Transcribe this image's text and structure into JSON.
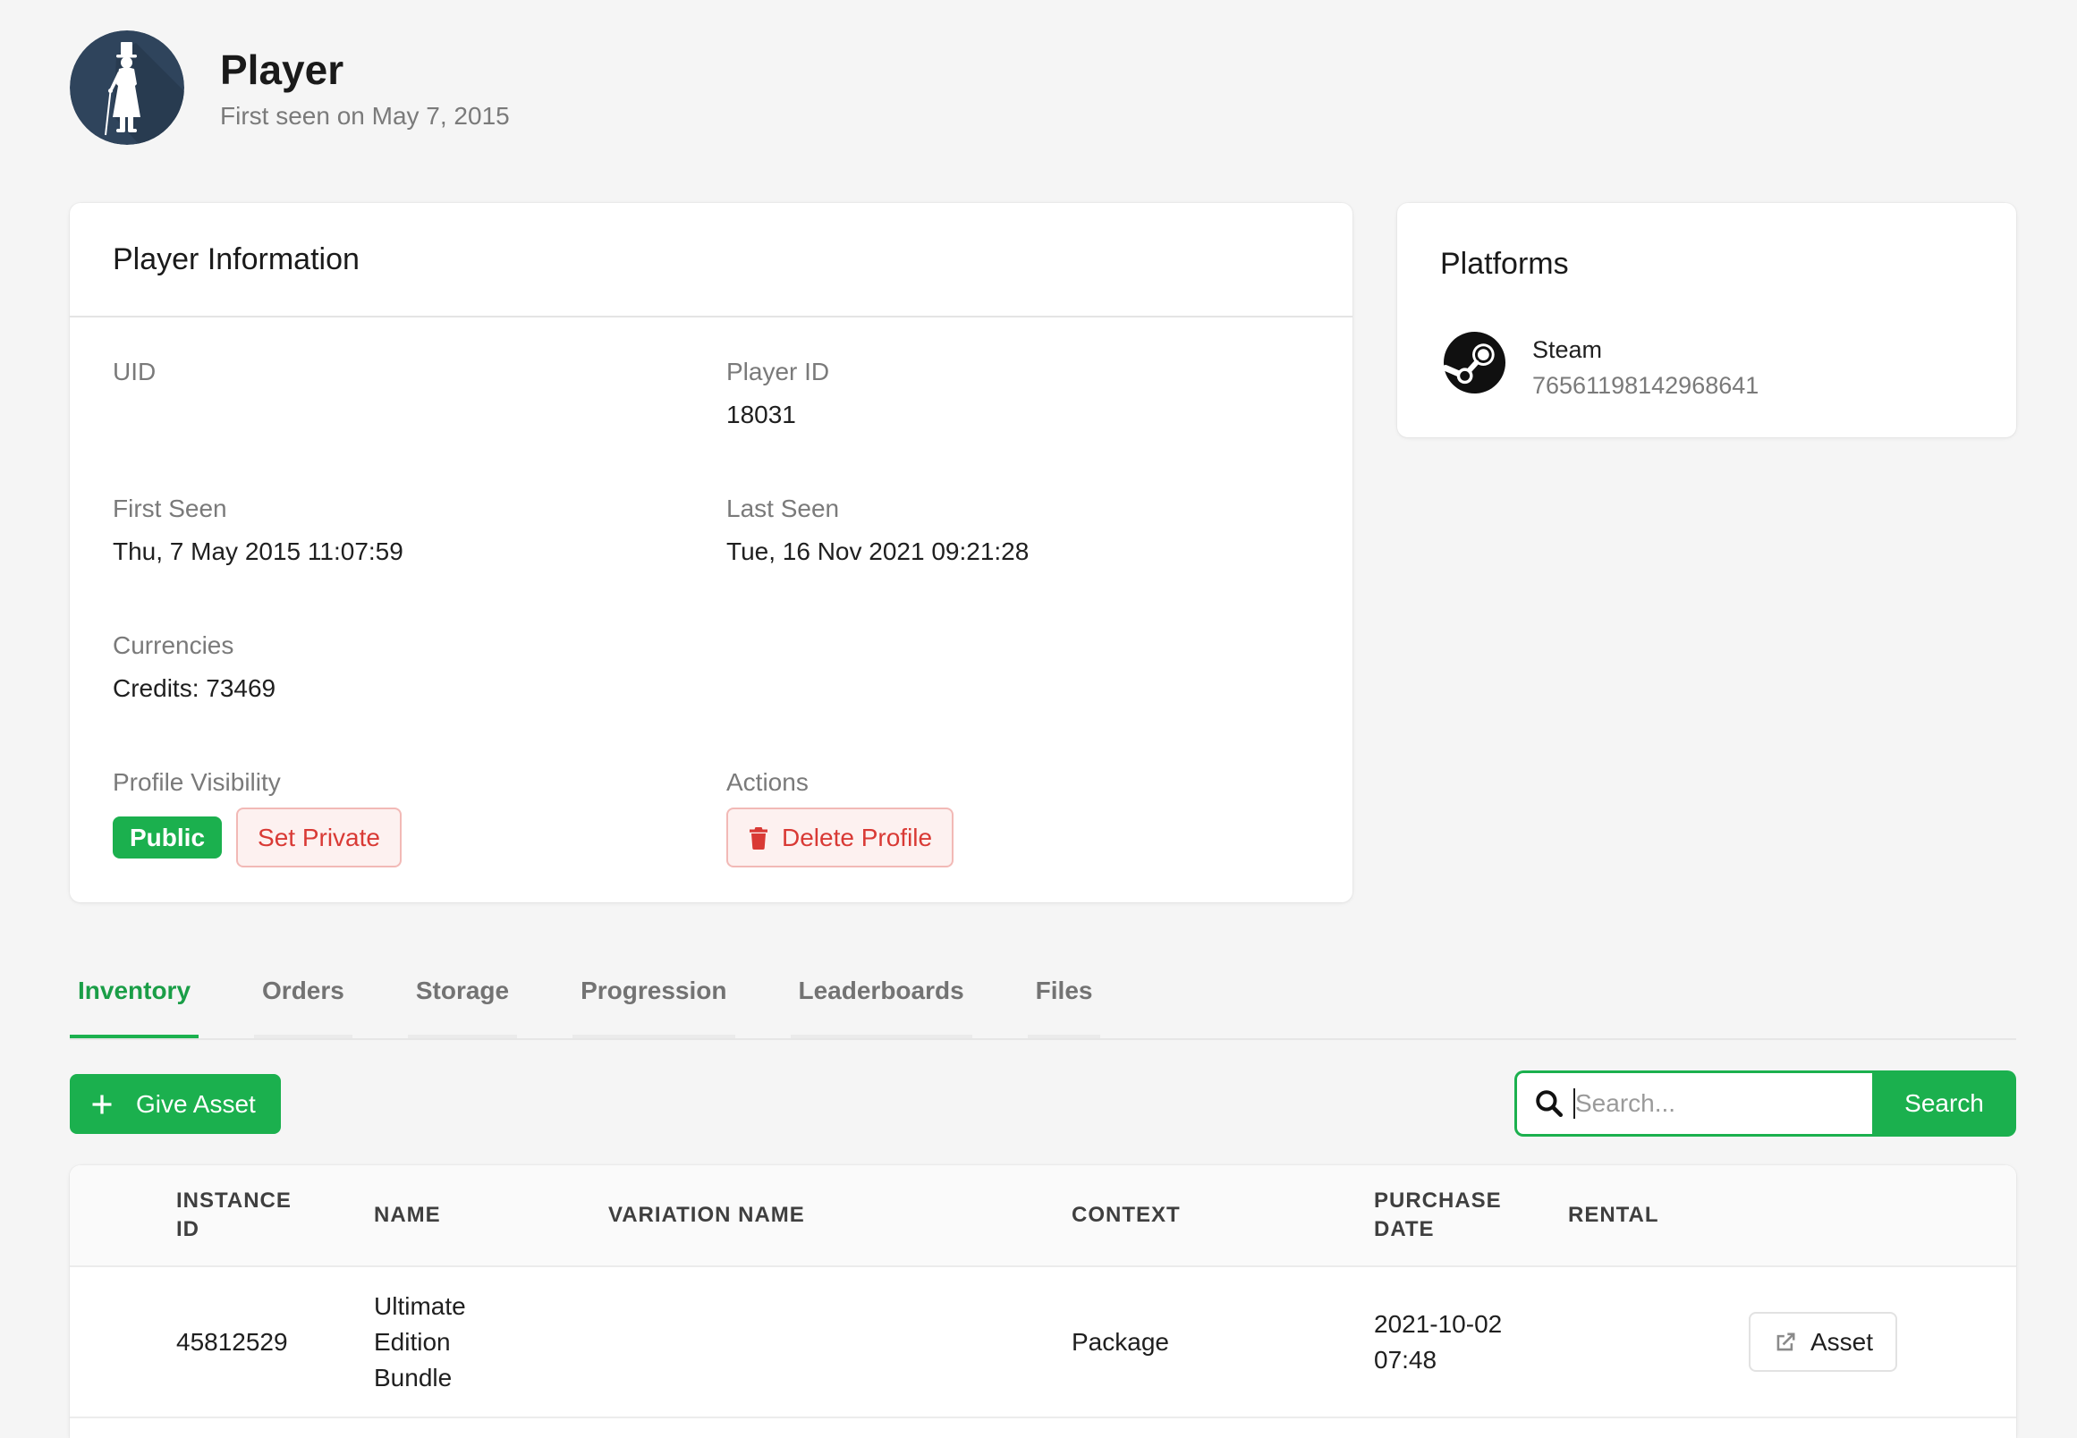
{
  "header": {
    "title": "Player",
    "subtitle": "First seen on May 7, 2015",
    "avatar_icon": "gentleman-silhouette-icon"
  },
  "player_info": {
    "title": "Player Information",
    "uid": {
      "label": "UID"
    },
    "player_id": {
      "label": "Player ID",
      "value": "18031"
    },
    "first_seen": {
      "label": "First Seen",
      "value": "Thu, 7 May 2015 11:07:59"
    },
    "last_seen": {
      "label": "Last Seen",
      "value": "Tue, 16 Nov 2021 09:21:28"
    },
    "currencies": {
      "label": "Currencies",
      "value": "Credits: 73469"
    },
    "profile_visibility": {
      "label": "Profile Visibility",
      "status_badge": "Public",
      "toggle_button": "Set Private"
    },
    "actions": {
      "label": "Actions",
      "delete_button": "Delete Profile",
      "delete_icon": "trash-icon"
    }
  },
  "platforms": {
    "title": "Platforms",
    "items": [
      {
        "name": "Steam",
        "account_id": "76561198142968641",
        "icon": "steam-icon"
      }
    ]
  },
  "tabs": [
    {
      "label": "Inventory",
      "active": true
    },
    {
      "label": "Orders",
      "active": false
    },
    {
      "label": "Storage",
      "active": false
    },
    {
      "label": "Progression",
      "active": false
    },
    {
      "label": "Leaderboards",
      "active": false
    },
    {
      "label": "Files",
      "active": false
    }
  ],
  "toolbar": {
    "give_asset_label": "Give Asset",
    "give_asset_icon": "plus-icon",
    "search_placeholder": "Search...",
    "search_icon": "search-icon",
    "search_button_label": "Search"
  },
  "inventory_table": {
    "columns": [
      "INSTANCE ID",
      "NAME",
      "VARIATION NAME",
      "CONTEXT",
      "PURCHASE DATE",
      "RENTAL"
    ],
    "rows": [
      {
        "instance_id": "45812529",
        "name": "Ultimate Edition Bundle",
        "context": "Package",
        "purchase_date": "2021-10-02 07:48",
        "action_label": "Asset",
        "action_icon": "external-link-icon"
      }
    ]
  },
  "colors": {
    "accent": "#1bb04e",
    "danger": "#d93a35",
    "avatar_bg": "#2f445c",
    "page_bg": "#f5f5f5"
  }
}
